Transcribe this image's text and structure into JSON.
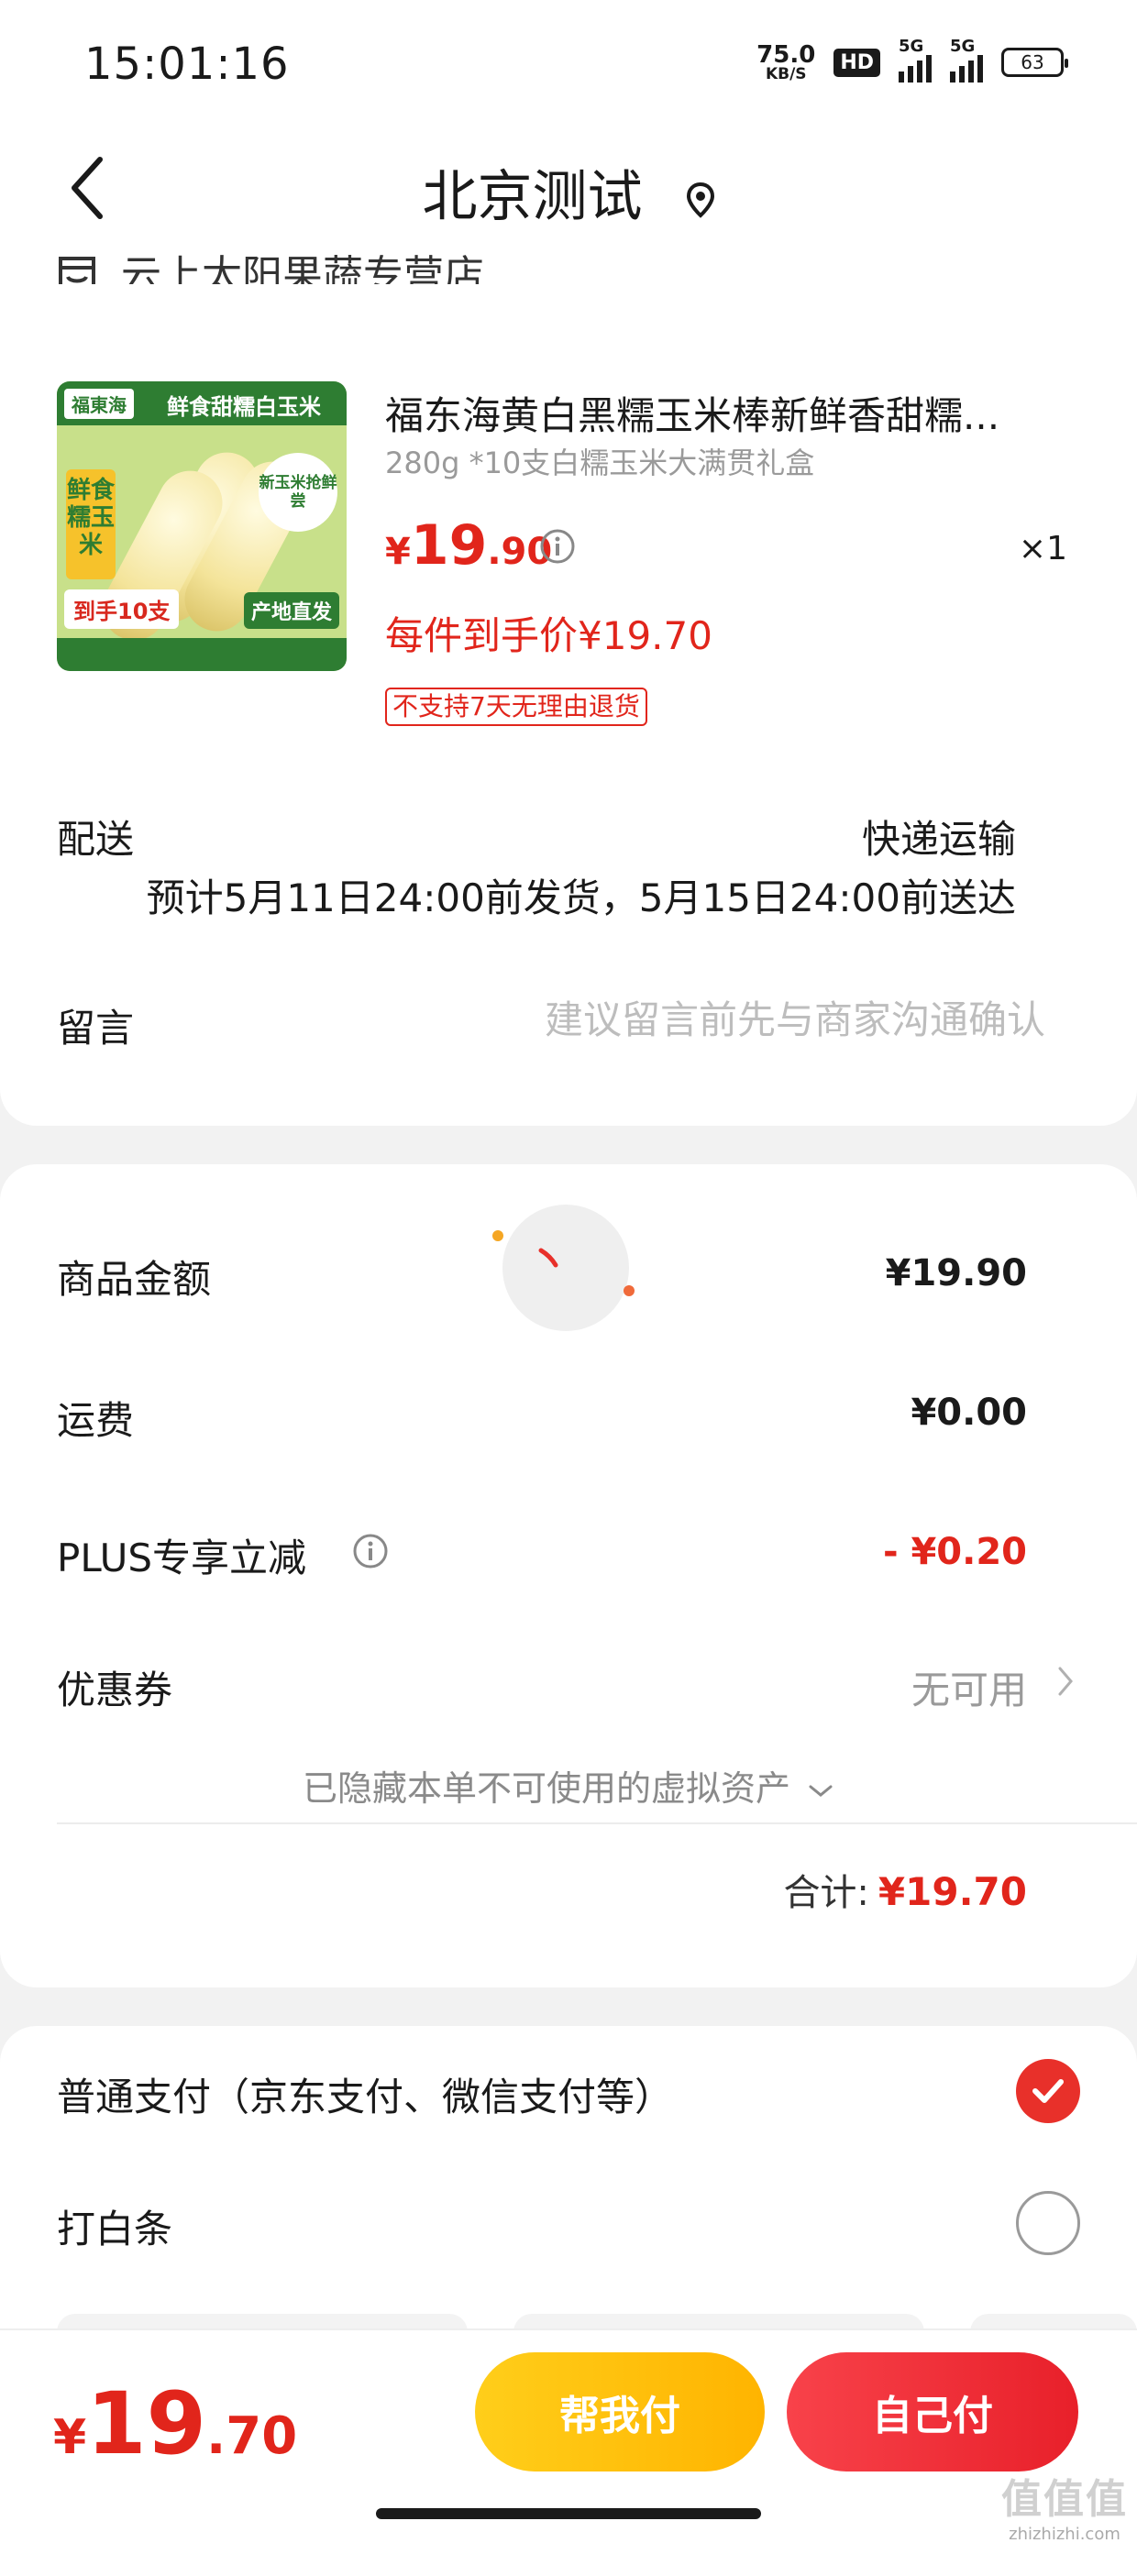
{
  "status_bar": {
    "time": "15:01:16",
    "net_speed_value": "75.0",
    "net_speed_unit": "KB/S",
    "hd_label": "HD",
    "signal1_label": "5G",
    "signal2_label": "5G",
    "battery_level": "63"
  },
  "header": {
    "title": "北京测试",
    "back_icon": "chevron-left-icon",
    "location_icon": "location-pin-icon"
  },
  "store": {
    "name": "云上太阳果蔬专营店"
  },
  "product": {
    "title": "福东海黄白黑糯玉米棒新鲜香甜糯...",
    "spec": "280g *10支白糯玉米大满贯礼盒",
    "price_currency": "¥",
    "price_int": "19",
    "price_dec": ".90",
    "quantity": "×1",
    "member_price": "每件到手价¥19.70",
    "return_policy": "不支持7天无理由退货",
    "image_text": {
      "brand": "福東海",
      "headline": "鲜食甜糯白玉米",
      "side": "鲜食糯玉米",
      "badge": "新玉米抢鲜尝",
      "bottom_left": "到手10支",
      "bottom_right": "产地直发"
    }
  },
  "delivery": {
    "label": "配送",
    "type": "快递运输",
    "estimate": "预计5月11日24:00前发货，5月15日24:00前送达"
  },
  "message": {
    "label": "留言",
    "placeholder": "建议留言前先与商家沟通确认"
  },
  "amounts": {
    "goods_label": "商品金额",
    "goods_value": "¥19.90",
    "freight_label": "运费",
    "freight_value": "¥0.00",
    "plus_label": "PLUS专享立减",
    "plus_value": "- ¥0.20",
    "coupon_label": "优惠券",
    "coupon_value": "无可用",
    "hidden_assets": "已隐藏本单不可使用的虚拟资产",
    "total_label": "合计:",
    "total_value": "¥19.70"
  },
  "payment": {
    "normal_label": "普通支付（京东支付、微信支付等）",
    "normal_selected": true,
    "baitiao_label": "打白条",
    "baitiao_selected": false
  },
  "bottom_bar": {
    "price_currency": "¥",
    "price_int": "19",
    "price_dec": ".70",
    "help_pay_label": "帮我付",
    "self_pay_label": "自己付"
  },
  "watermark": {
    "logo": "值值值",
    "url": "zhizhizhi.com"
  },
  "colors": {
    "accent_red": "#e1251b",
    "help_pay_yellow": "#ffc107",
    "self_pay_red": "#f0323a"
  }
}
